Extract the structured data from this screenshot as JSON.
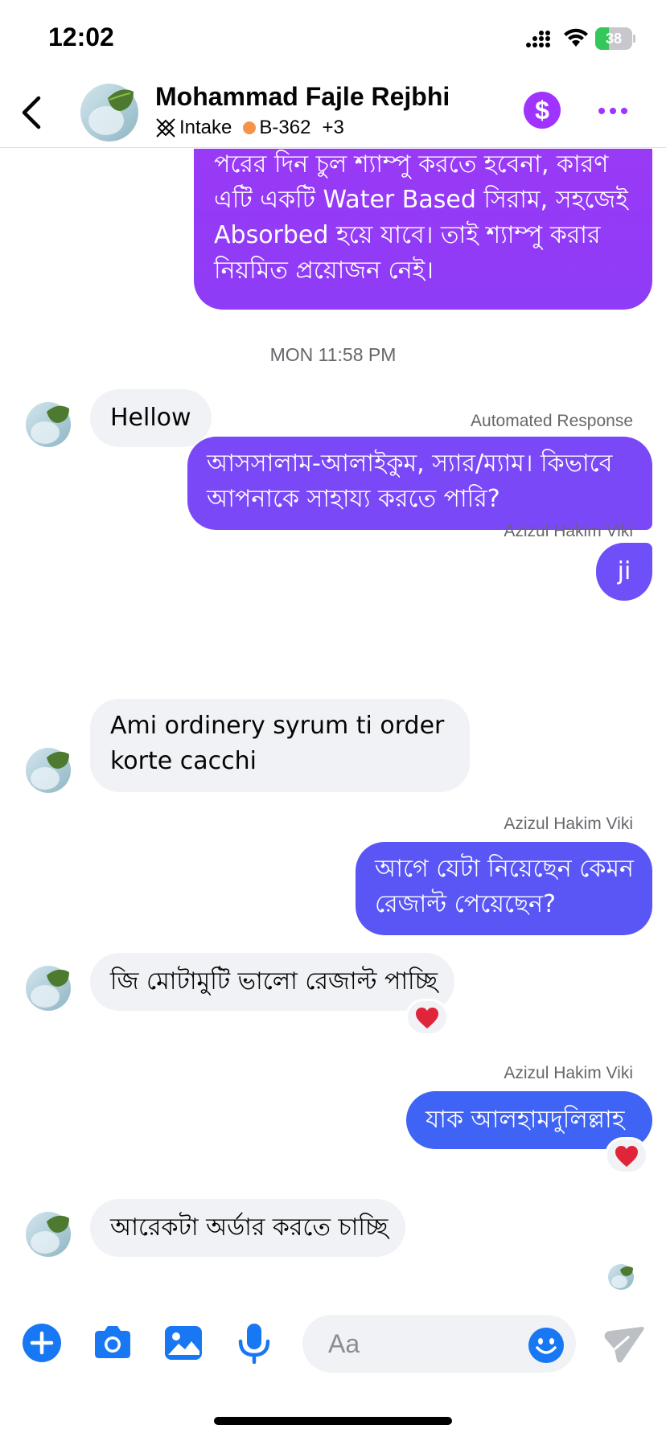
{
  "status_bar": {
    "time": "12:02",
    "battery_percent": 38,
    "battery_label": "38"
  },
  "header": {
    "back_label": "Back",
    "contact_name": "Mohammad Fajle Rejbhi",
    "tags": [
      {
        "icon": "intake-icon",
        "label": "Intake"
      },
      {
        "icon": "dot",
        "color": "#f5934a",
        "label": "B-362"
      },
      {
        "label": "+3"
      }
    ],
    "payment_symbol": "$",
    "accent_color": "#a033ff"
  },
  "messages": {
    "m1": {
      "lines": [
        "পরের দিন চুল শ্যাম্পু করতে হবেনা, কারণ",
        "এটি একটি Water Based সিরাম, সহজেই",
        "Absorbed হয়ে যাবে। তাই শ্যাম্পু করার",
        "নিয়মিত প্রয়োজন নেই।"
      ]
    },
    "timestamp": "MON 11:58 PM",
    "m2": {
      "text": "Hellow"
    },
    "m3": {
      "meta": "Automated Response",
      "lines": [
        "আসসালাম-আলাইকুম, স্যার/ম্যাম। কিভাবে",
        "আপনাকে সাহায্য করতে পারি?"
      ]
    },
    "m4": {
      "meta": "Azizul Hakim Viki",
      "text": "ji"
    },
    "m5": {
      "lines": [
        "Ami ordinery syrum ti order",
        "korte cacchi"
      ]
    },
    "m6": {
      "meta": "Azizul Hakim Viki",
      "lines": [
        "আগে যেটা নিয়েছেন কেমন",
        "রেজাল্ট পেয়েছেন?"
      ]
    },
    "m7": {
      "text": "জি মোটামুটি ভালো রেজাল্ট পাচ্ছি",
      "reaction": "heart"
    },
    "m8": {
      "meta": "Azizul Hakim Viki",
      "text": "যাক আলহামদুলিল্লাহ",
      "reaction": "heart"
    },
    "m9": {
      "text": "আরেকটা অর্ডার করতে চাচ্ছি"
    }
  },
  "composer": {
    "placeholder": "Aa",
    "icons": [
      "plus-icon",
      "camera-icon",
      "gallery-icon",
      "microphone-icon",
      "emoji-icon",
      "send-icon"
    ],
    "accent_color": "#1877f2"
  }
}
